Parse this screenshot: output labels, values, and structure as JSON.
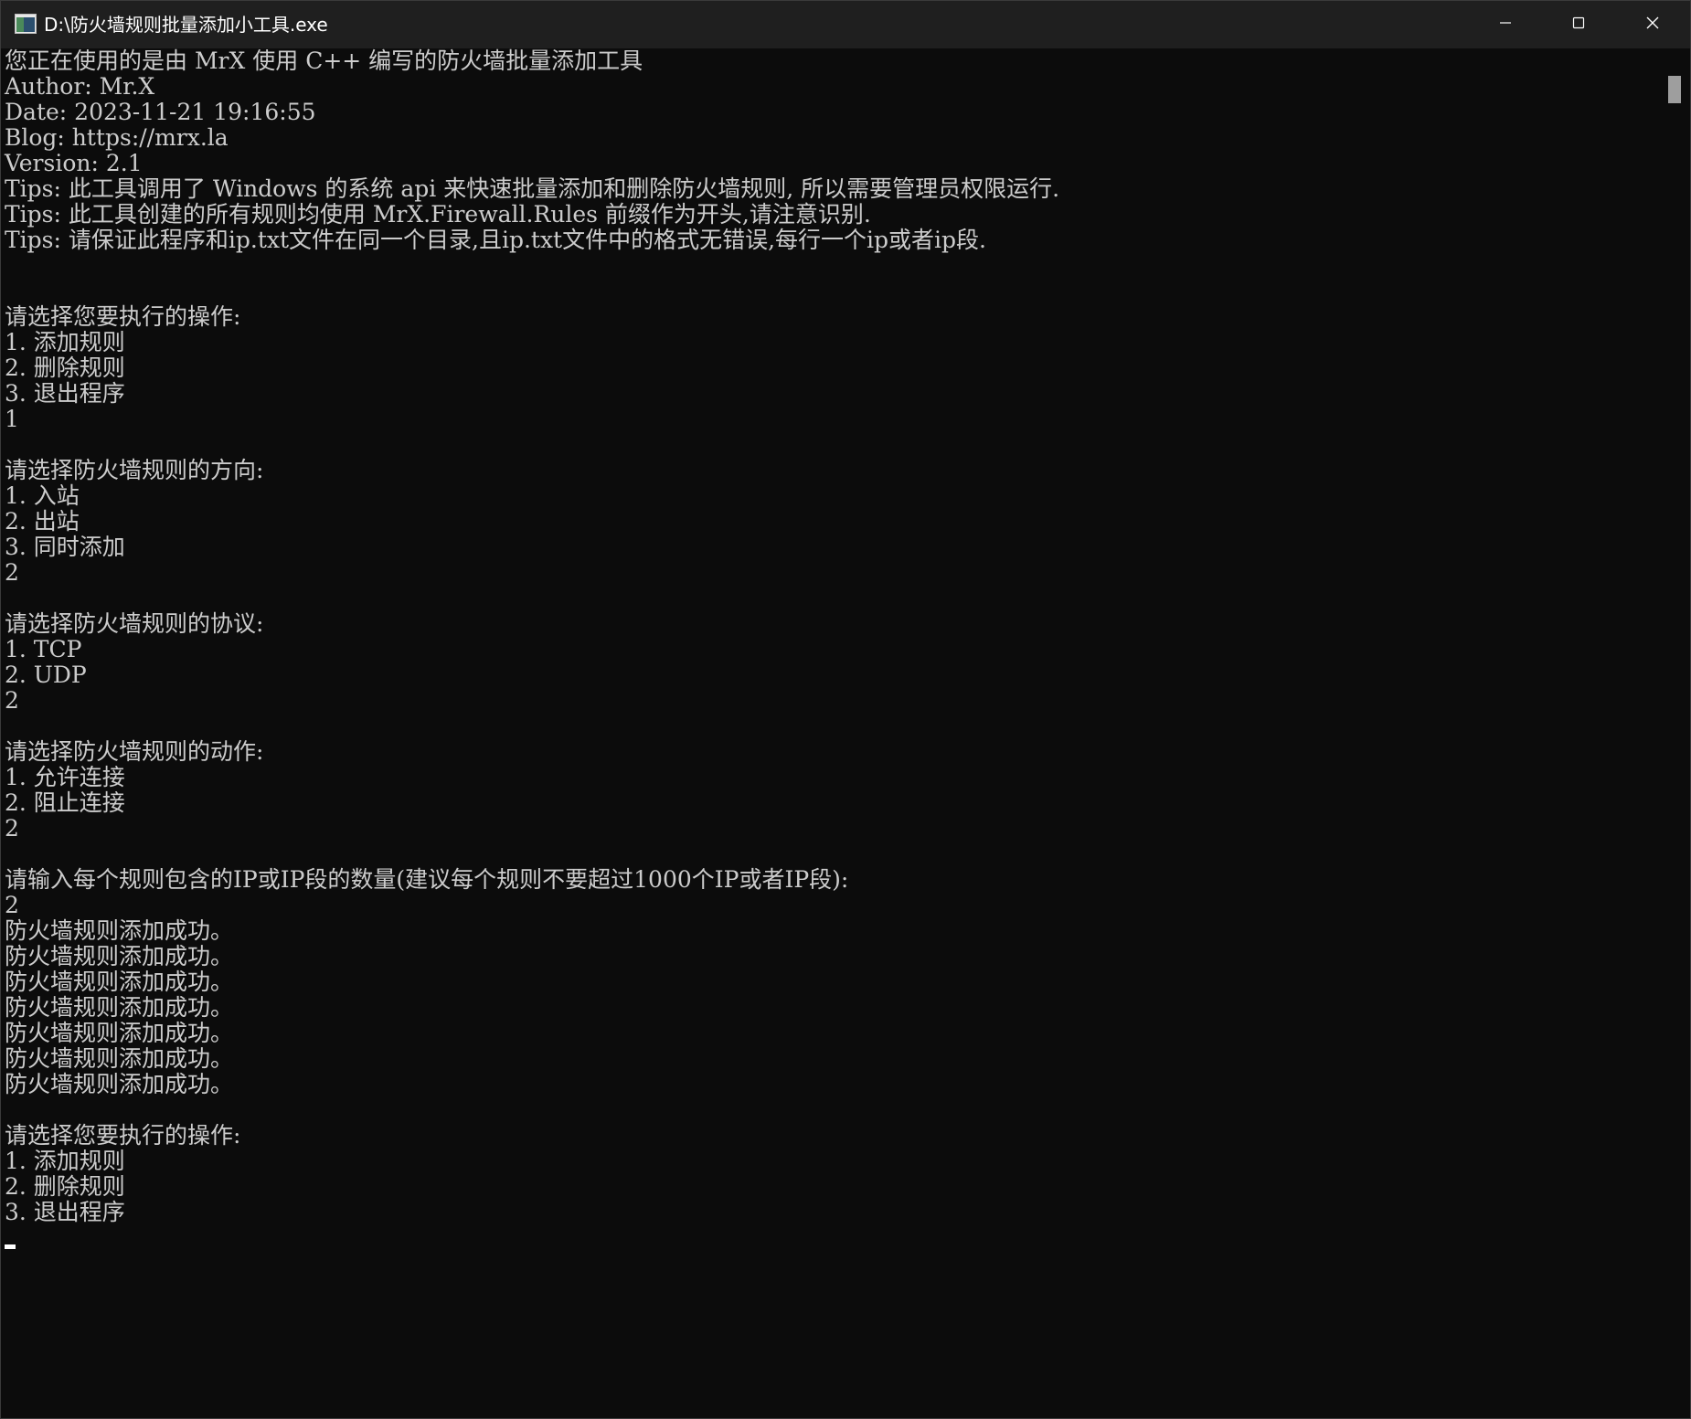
{
  "window": {
    "title": "D:\\防火墙规则批量添加小工具.exe"
  },
  "console": {
    "lines": [
      "您正在使用的是由 MrX 使用 C++ 编写的防火墙批量添加工具",
      "Author: Mr.X",
      "Date: 2023-11-21 19:16:55",
      "Blog: https://mrx.la",
      "Version: 2.1",
      "Tips: 此工具调用了 Windows 的系统 api 来快速批量添加和删除防火墙规则, 所以需要管理员权限运行.",
      "Tips: 此工具创建的所有规则均使用 MrX.Firewall.Rules 前缀作为开头,请注意识别.",
      "Tips: 请保证此程序和ip.txt文件在同一个目录,且ip.txt文件中的格式无错误,每行一个ip或者ip段.",
      "",
      "",
      "请选择您要执行的操作:",
      "1. 添加规则",
      "2. 删除规则",
      "3. 退出程序",
      "1",
      "",
      "请选择防火墙规则的方向:",
      "1. 入站",
      "2. 出站",
      "3. 同时添加",
      "2",
      "",
      "请选择防火墙规则的协议:",
      "1. TCP",
      "2. UDP",
      "2",
      "",
      "请选择防火墙规则的动作:",
      "1. 允许连接",
      "2. 阻止连接",
      "2",
      "",
      "请输入每个规则包含的IP或IP段的数量(建议每个规则不要超过1000个IP或者IP段):",
      "2",
      "防火墙规则添加成功。",
      "防火墙规则添加成功。",
      "防火墙规则添加成功。",
      "防火墙规则添加成功。",
      "防火墙规则添加成功。",
      "防火墙规则添加成功。",
      "防火墙规则添加成功。",
      "",
      "请选择您要执行的操作:",
      "1. 添加规则",
      "2. 删除规则",
      "3. 退出程序"
    ]
  },
  "icons": {
    "app": "console-window-icon",
    "minimize": "minimize-icon",
    "maximize": "maximize-icon",
    "close": "close-icon"
  },
  "colors": {
    "titlebar": "#1f1f1f",
    "background": "#0c0c0c",
    "text": "#cccccc",
    "scroll_thumb": "#9e9e9e"
  }
}
